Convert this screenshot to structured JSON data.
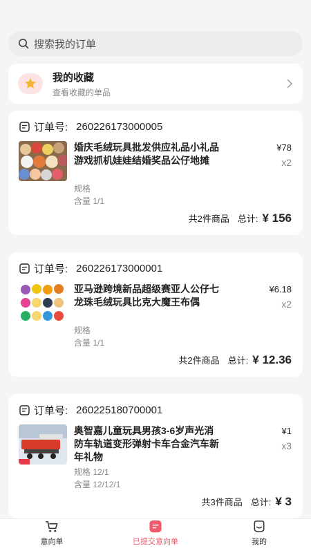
{
  "search": {
    "placeholder": "搜索我的订单"
  },
  "favorites": {
    "title": "我的收藏",
    "subtitle": "查看收藏的单品"
  },
  "orders": [
    {
      "no_label": "订单号:",
      "order_no": "260226173000005",
      "name": "婚庆毛绒玩具批发供应礼品小礼品游戏抓机娃娃结婚奖品公仔地摊",
      "price": "¥78",
      "qty": "x2",
      "spec": "规格",
      "content": "含量 1/1",
      "count_text": "共2件商品",
      "total_label": "总计:",
      "total": "¥ 156"
    },
    {
      "no_label": "订单号:",
      "order_no": "260226173000001",
      "name": "亚马逊跨境新品超级赛亚人公仔七龙珠毛绒玩具比克大魔王布偶",
      "price": "¥6.18",
      "qty": "x2",
      "spec": "规格",
      "content": "含量 1/1",
      "count_text": "共2件商品",
      "total_label": "总计:",
      "total": "¥ 12.36"
    },
    {
      "no_label": "订单号:",
      "order_no": "260225180700001",
      "name": "奥智嘉儿童玩具男孩3-6岁声光消防车轨道变形弹射卡车合金汽车新年礼物",
      "price": "¥1",
      "qty": "x3",
      "spec": "规格 12/1",
      "content": "含量 12/12/1",
      "count_text": "共3件商品",
      "total_label": "总计:",
      "total": "¥ 3"
    }
  ],
  "tabbar": {
    "items": [
      {
        "label": "意向单",
        "icon": "cart-icon"
      },
      {
        "label": "已提交意向单",
        "icon": "submitted-list-icon"
      },
      {
        "label": "我的",
        "icon": "profile-face-icon"
      }
    ],
    "active_color": "#f05a6c"
  }
}
